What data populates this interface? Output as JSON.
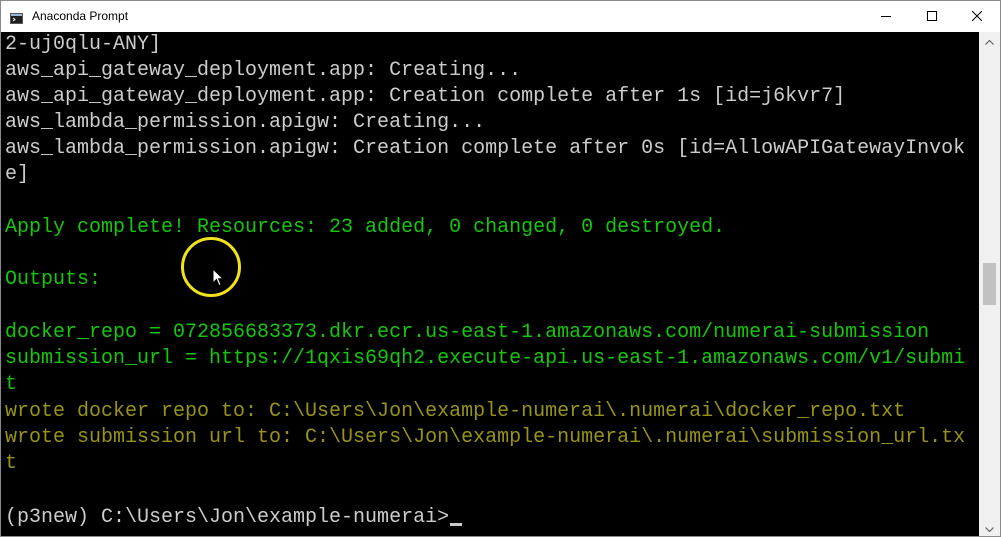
{
  "window": {
    "title": "Anaconda Prompt",
    "icon": "console-icon",
    "controls": {
      "minimize": "minimize-icon",
      "maximize": "maximize-icon",
      "close": "close-icon"
    }
  },
  "console": {
    "colors": {
      "background": "#000000",
      "default_text": "#cccccc",
      "success_text": "#16c60c",
      "info_text": "#979319"
    },
    "lines": [
      {
        "text": "2-uj0qlu-ANY]",
        "color": "white"
      },
      {
        "text": "aws_api_gateway_deployment.app: Creating...",
        "color": "white"
      },
      {
        "text": "aws_api_gateway_deployment.app: Creation complete after 1s [id=j6kvr7]",
        "color": "white"
      },
      {
        "text": "aws_lambda_permission.apigw: Creating...",
        "color": "white"
      },
      {
        "text": "aws_lambda_permission.apigw: Creation complete after 0s [id=AllowAPIGatewayInvok",
        "color": "white"
      },
      {
        "text": "e]",
        "color": "white"
      },
      {
        "text": "",
        "color": "white"
      },
      {
        "text": "Apply complete! Resources: 23 added, 0 changed, 0 destroyed.",
        "color": "green"
      },
      {
        "text": "",
        "color": "white"
      },
      {
        "text": "Outputs:",
        "color": "green"
      },
      {
        "text": "",
        "color": "white"
      },
      {
        "text": "docker_repo = 072856683373.dkr.ecr.us-east-1.amazonaws.com/numerai-submission",
        "color": "green"
      },
      {
        "text": "submission_url = https://1qxis69qh2.execute-api.us-east-1.amazonaws.com/v1/submi",
        "color": "green"
      },
      {
        "text": "t",
        "color": "green"
      },
      {
        "text": "wrote docker repo to: C:\\Users\\Jon\\example-numerai\\.numerai\\docker_repo.txt",
        "color": "olive"
      },
      {
        "text": "wrote submission url to: C:\\Users\\Jon\\example-numerai\\.numerai\\submission_url.tx",
        "color": "olive"
      },
      {
        "text": "t",
        "color": "olive"
      },
      {
        "text": "",
        "color": "white"
      },
      {
        "text": "",
        "color": "white"
      }
    ],
    "prompt": "(p3new) C:\\Users\\Jon\\example-numerai>"
  },
  "scrollbar": {
    "position_fraction": 0.5,
    "up_icon": "scroll-up-arrow-icon",
    "down_icon": "scroll-down-arrow-icon"
  },
  "overlay": {
    "highlight_color": "#f2e21c",
    "pointer_icon": "mouse-pointer-icon"
  }
}
